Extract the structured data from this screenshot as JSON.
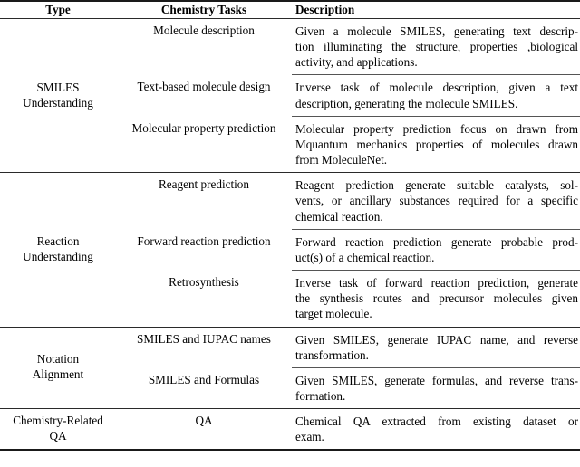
{
  "table": {
    "caption_present": false,
    "columns": [
      "Type",
      "Chemistry Tasks",
      "Description"
    ],
    "header": {
      "type": "Type",
      "task": "Chemistry Tasks",
      "description": "Description"
    },
    "sections": [
      {
        "type_label_line1": "SMILES",
        "type_label_line2": "Understanding",
        "rows": [
          {
            "task": "Molecule description",
            "desc_lines": [
              "Given a molecule SMILES, generating text descrip-",
              "tion illuminating the structure, properties ,biological",
              "activity, and applications."
            ],
            "desc_full": "Given a molecule SMILES, generating text description illuminating the structure, properties ,biological activity, and applications."
          },
          {
            "task": "Text-based molecule design",
            "desc_lines": [
              "Inverse task of molecule description, given a text",
              "description, generating the molecule SMILES."
            ],
            "desc_full": "Inverse task of molecule description, given a text description, generating the molecule SMILES."
          },
          {
            "task": "Molecular property prediction",
            "desc_lines": [
              "Molecular property prediction focus on drawn from",
              "Mquantum mechanics properties of molecules drawn",
              "from MoleculeNet."
            ],
            "desc_full": "Molecular property prediction focus on drawn from Mquantum mechanics properties of molecules drawn from MoleculeNet."
          }
        ]
      },
      {
        "type_label_line1": "Reaction",
        "type_label_line2": "Understanding",
        "rows": [
          {
            "task": "Reagent prediction",
            "desc_lines": [
              "Reagent prediction generate suitable catalysts, sol-",
              "vents, or ancillary substances required for a specific",
              "chemical reaction."
            ],
            "desc_full": "Reagent prediction generate suitable catalysts, solvents, or ancillary substances required for a specific chemical reaction."
          },
          {
            "task": "Forward reaction prediction",
            "desc_lines": [
              "Forward reaction prediction generate probable prod-",
              "uct(s) of a chemical reaction."
            ],
            "desc_full": "Forward reaction prediction generate probable product(s) of a chemical reaction."
          },
          {
            "task": "Retrosynthesis",
            "desc_lines": [
              "Inverse task of forward reaction prediction, generate",
              "the synthesis routes and precursor molecules given",
              "target molecule."
            ],
            "desc_full": "Inverse task of forward reaction prediction, generate the synthesis routes and precursor molecules given target molecule."
          }
        ]
      },
      {
        "type_label_line1": "Notation",
        "type_label_line2": "Alignment",
        "rows": [
          {
            "task": "SMILES and IUPAC names",
            "desc_lines": [
              "Given SMILES, generate IUPAC name, and reverse",
              "transformation."
            ],
            "desc_full": "Given SMILES, generate IUPAC name, and reverse transformation."
          },
          {
            "task": "SMILES and Formulas",
            "desc_lines": [
              "Given SMILES, generate formulas, and reverse trans-",
              "formation."
            ],
            "desc_full": "Given SMILES, generate formulas, and reverse transformation."
          }
        ]
      },
      {
        "type_label_line1": "Chemistry-Related",
        "type_label_line2": "QA",
        "rows": [
          {
            "task": "QA",
            "desc_lines": [
              "Chemical QA extracted from existing dataset or",
              "exam."
            ],
            "desc_full": "Chemical QA extracted from existing dataset or exam."
          }
        ]
      }
    ]
  },
  "style": {
    "text_color": "#000000",
    "rule_color": "#1a1a1a",
    "thin_rule_color": "#555555",
    "background": "#ffffff"
  }
}
